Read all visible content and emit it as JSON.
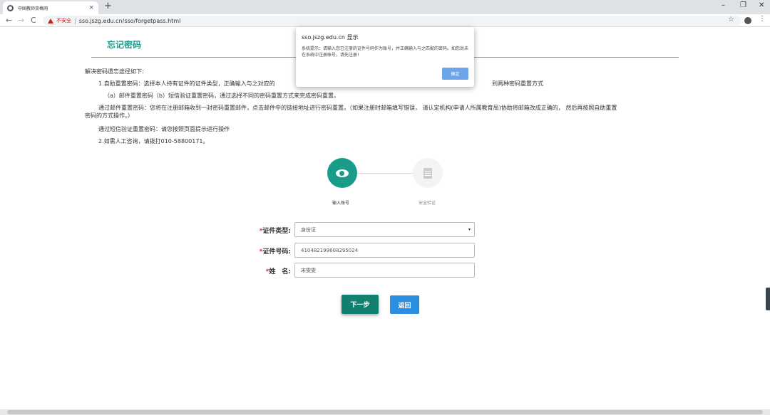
{
  "browser": {
    "tab_title": "中国教师资格网",
    "tab_close": "×",
    "new_tab": "+",
    "window_controls": {
      "minimize": "–",
      "maximize": "❐",
      "close": "✕"
    },
    "nav": {
      "back": "←",
      "forward": "→",
      "reload": "C"
    },
    "security_label": "不安全",
    "url": "sso.jszg.edu.cn/sso/forgetpass.html"
  },
  "page": {
    "title": "忘记密码",
    "instructions": {
      "intro": "解决密码遗忘途径如下:",
      "line1a": "1.自助重置密码：选择本人持有证件的证件类型，正确输入与之对应的",
      "line1b": "到两种密码重置方式",
      "line2": "（a）邮件重置密码（b）短信验证重置密码，通过选择不同的密码重置方式来完成密码重置。",
      "line3a": "通过邮件重置密码：您将在注册邮箱收到一封密码重置邮件，点击邮件中的链接地址进行密码重置。（如果注册时邮箱填写错误， 请认定机构(申请人所属教育局)协助将邮箱改成正确的， 然后再按照自助重置",
      "line3b": "密码的方式操作。）",
      "line4": "通过短信验证重置密码：请您按照页面提示进行操作",
      "line5": "2.如需人工咨询，请拨打010-58800171。"
    },
    "steps": [
      {
        "label": "输入账号",
        "icon": "eye-icon",
        "active": true
      },
      {
        "label": "安全验证",
        "icon": "document-icon",
        "active": false
      }
    ],
    "form": {
      "required_mark": "*",
      "id_type": {
        "label": "证件类型:",
        "value": "身份证",
        "caret": "▾"
      },
      "id_number": {
        "label": "证件号码:",
        "value": "410482199608295024"
      },
      "name": {
        "label": "姓　名:",
        "value": "宋雯雯"
      }
    },
    "buttons": {
      "next": "下一步",
      "back": "返回"
    }
  },
  "dialog": {
    "title": "sso.jszg.edu.cn 显示",
    "message": "系统提示：请输入您已注册的证件号码作为账号，并正确输入与之匹配的密码。如您尚未在系统中注册账号，请先注册！",
    "ok": "确定"
  },
  "colors": {
    "accent": "#1a9c8a",
    "button_next": "#11806e",
    "button_back": "#2a8fe0",
    "dialog_ok": "#6ea4e8",
    "insecure": "#c5221f"
  }
}
